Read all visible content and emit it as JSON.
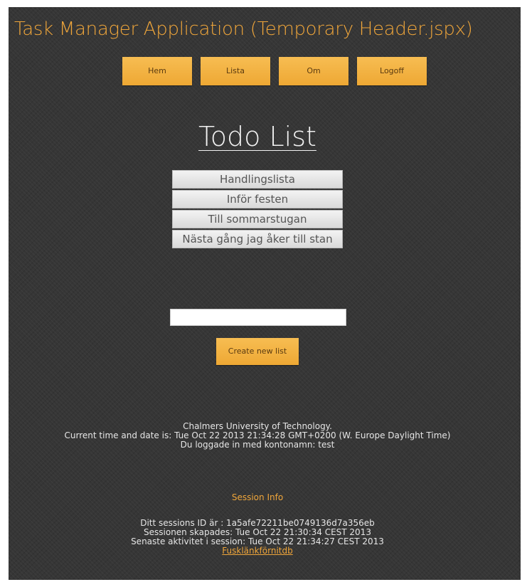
{
  "header": {
    "title": "Task Manager Application (Temporary Header.jspx)"
  },
  "nav": {
    "items": [
      {
        "label": "Hem"
      },
      {
        "label": "Lista"
      },
      {
        "label": "Om"
      },
      {
        "label": "Logoff"
      }
    ]
  },
  "main": {
    "heading": "Todo List",
    "lists": [
      {
        "label": "Handlingslista"
      },
      {
        "label": "Inför festen"
      },
      {
        "label": "Till sommarstugan"
      },
      {
        "label": "Nästa gång jag åker till stan"
      }
    ],
    "new_list_input": {
      "value": "",
      "placeholder": ""
    },
    "create_button": "Create new list"
  },
  "footer": {
    "university": "Chalmers University of Technology.",
    "datetime": "Current time and date is: Tue Oct 22 2013 21:34:28 GMT+0200 (W. Europe Daylight Time)",
    "login": "Du loggade in med kontonamn: test"
  },
  "session": {
    "title": "Session Info",
    "id_line": "Ditt sessions ID är : 1a5afe72211be0749136d7a356eb",
    "created_line": "Sessionen skapades: Tue Oct 22 21:30:34 CEST 2013",
    "activity_line": "Senaste aktivitet i session: Tue Oct 22 21:34:27 CEST 2013",
    "link": "Fusklänkförnitdb"
  },
  "colors": {
    "accent": "#f0a63a",
    "button": "#f5b444",
    "background": "#363636"
  }
}
